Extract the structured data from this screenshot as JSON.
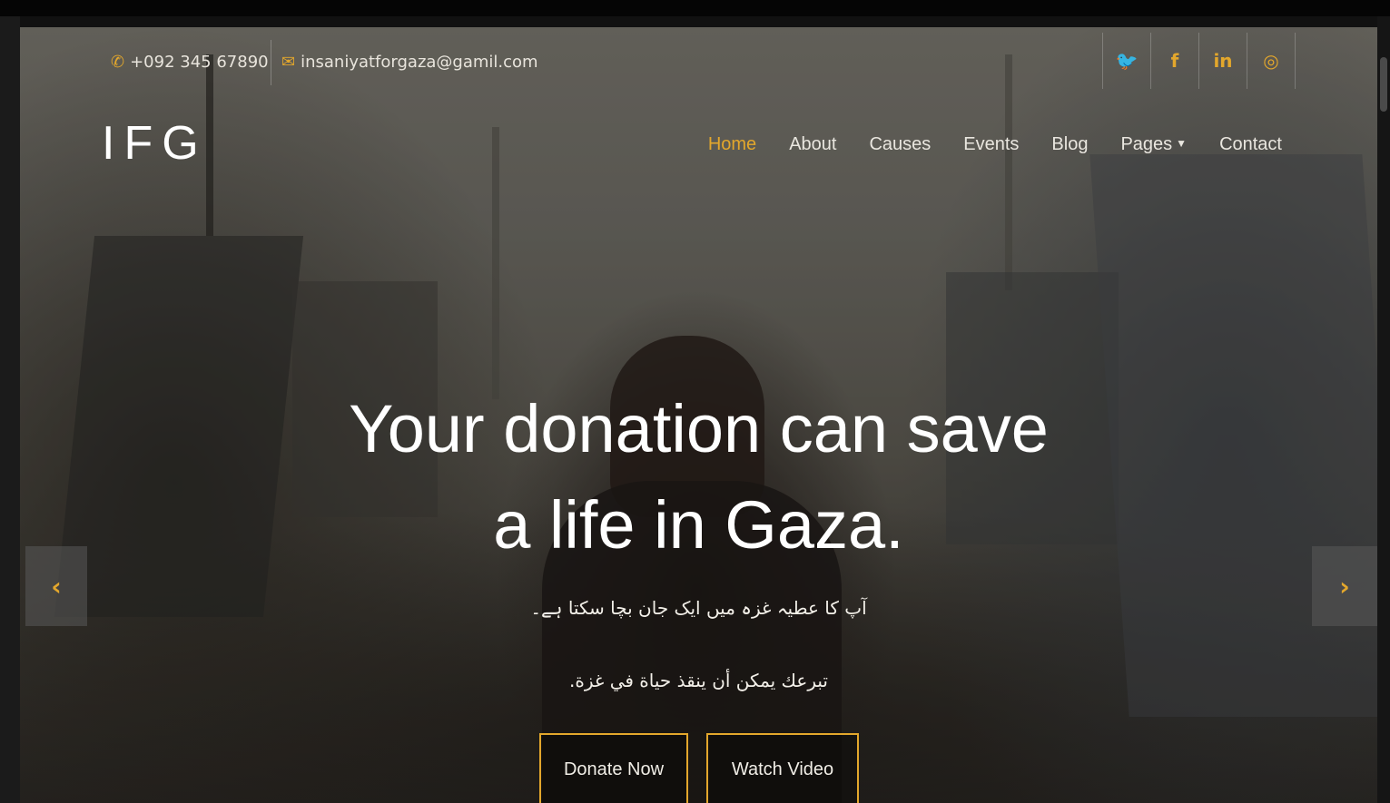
{
  "topbar": {
    "phone": "+092 345 67890",
    "email": "insaniyatforgaza@gamil.com",
    "phone_icon": "phone-icon",
    "email_icon": "envelope-icon",
    "social": [
      {
        "name": "twitter-icon",
        "glyph": "🐦"
      },
      {
        "name": "facebook-icon",
        "glyph": "f"
      },
      {
        "name": "linkedin-icon",
        "glyph": "in"
      },
      {
        "name": "instagram-icon",
        "glyph": "◎"
      }
    ]
  },
  "header": {
    "logo": "IFG",
    "nav": [
      {
        "label": "Home",
        "active": true
      },
      {
        "label": "About"
      },
      {
        "label": "Causes"
      },
      {
        "label": "Events"
      },
      {
        "label": "Blog"
      },
      {
        "label": "Pages",
        "dropdown": true
      },
      {
        "label": "Contact"
      }
    ]
  },
  "hero": {
    "headline_line1": "Your donation can save",
    "headline_line2": "a life in Gaza.",
    "urdu_line": "آپ کا عطیہ غزہ میں ایک جان بچا سکتا ہے۔",
    "arabic_line": "تبرعك يمكن أن ينقذ حياة في غزة.",
    "donate_label": "Donate Now",
    "watch_label": "Watch Video",
    "prev_glyph": "‹",
    "next_glyph": "›"
  },
  "colors": {
    "accent": "#e3a72c",
    "text": "#ffffff"
  }
}
